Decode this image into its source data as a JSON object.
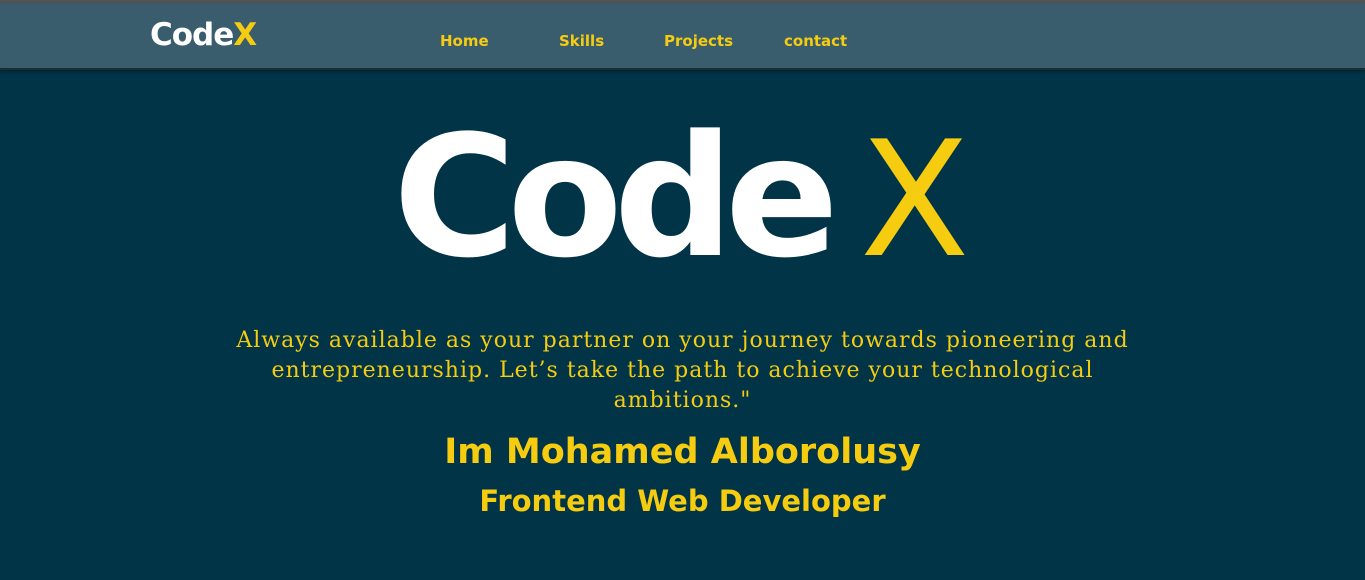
{
  "navbar": {
    "brand": {
      "part1": "Code",
      "part2": "X"
    },
    "links": [
      "Home",
      "Skills",
      "Projects",
      "contact"
    ]
  },
  "hero": {
    "logo": {
      "part1": "Code",
      "part2": "X"
    },
    "tagline": "Always available as your partner on your journey towards pioneering and entrepreneurship. Let’s take the path to achieve your technological ambitions.\"",
    "name": "Im Mohamed Alborolusy",
    "role": "Frontend Web Developer"
  },
  "colors": {
    "background": "#023447",
    "navbar": "#3a5d6e",
    "accent": "#f5cc10",
    "text": "#ffffff"
  }
}
